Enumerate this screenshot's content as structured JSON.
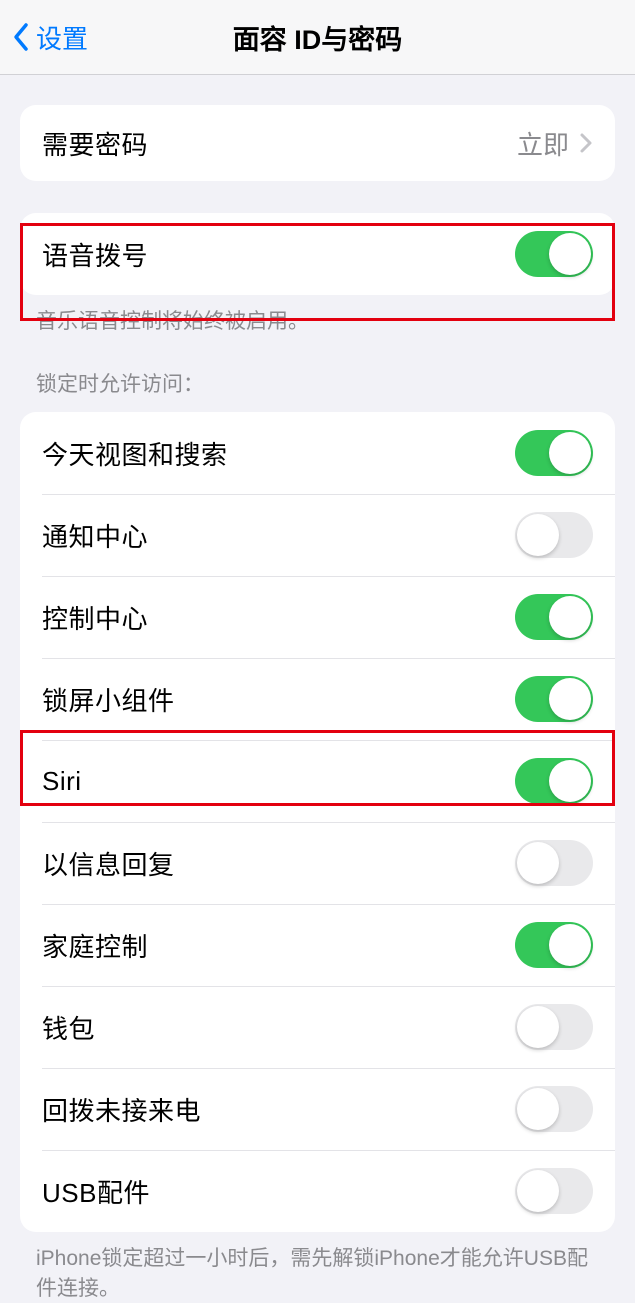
{
  "nav": {
    "back_label": "设置",
    "title": "面容 ID与密码"
  },
  "passcode_group": {
    "require_passcode_label": "需要密码",
    "require_passcode_value": "立即"
  },
  "voice_dial": {
    "label": "语音拨号",
    "on": true,
    "footer": "音乐语音控制将始终被启用。"
  },
  "lock_access": {
    "header": "锁定时允许访问：",
    "items": [
      {
        "label": "今天视图和搜索",
        "on": true
      },
      {
        "label": "通知中心",
        "on": false
      },
      {
        "label": "控制中心",
        "on": true
      },
      {
        "label": "锁屏小组件",
        "on": true
      },
      {
        "label": "Siri",
        "on": true
      },
      {
        "label": "以信息回复",
        "on": false
      },
      {
        "label": "家庭控制",
        "on": true
      },
      {
        "label": "钱包",
        "on": false
      },
      {
        "label": "回拨未接来电",
        "on": false
      },
      {
        "label": "USB配件",
        "on": false
      }
    ],
    "footer": "iPhone锁定超过一小时后，需先解锁iPhone才能允许USB配件连接。"
  }
}
